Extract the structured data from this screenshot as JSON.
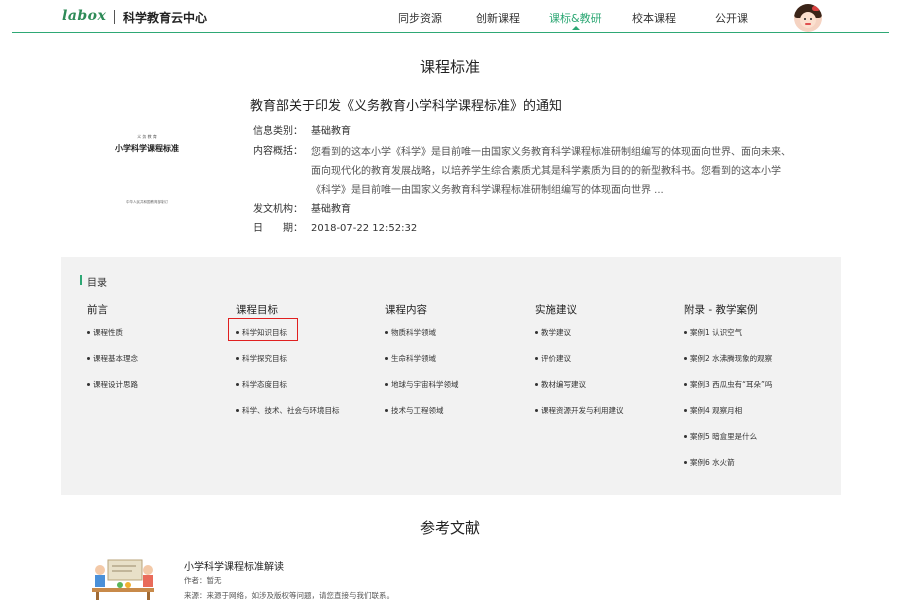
{
  "header": {
    "logo": "labox",
    "site_title": "科学教育云中心",
    "nav": [
      {
        "label": "同步资源",
        "active": false
      },
      {
        "label": "创新课程",
        "active": false
      },
      {
        "label": "课标&教研",
        "active": true
      },
      {
        "label": "校本课程",
        "active": false
      },
      {
        "label": "公开课",
        "active": false
      }
    ],
    "accent_color": "#2ea875"
  },
  "main": {
    "section_title": "课程标准",
    "document": {
      "cover_top": "义 务 教 育",
      "cover_title": "小学科学课程标准",
      "cover_bottom": "中华人民共和国教育部制订",
      "title": "教育部关于印发《义务教育小学科学课程标准》的通知",
      "meta": [
        {
          "label": "信息类别：",
          "value": "基础教育"
        },
        {
          "label": "内容概括：",
          "value": ""
        },
        {
          "label": "发文机构：",
          "value": "基础教育"
        },
        {
          "label": "日　　期：",
          "value": "2018-07-22 12:52:32"
        }
      ],
      "summary_lines": [
        "您看到的这本小学《科学》是目前唯一由国家义务教育科学课程标准研制组编写的体现面向世界、面向未来、",
        "面向现代化的教育发展战略，以培养学生综合素质尤其是科学素质为目的的新型教科书。您看到的这本小学",
        "《科学》是目前唯一由国家义务教育科学课程标准研制组编写的体现面向世界 ..."
      ]
    },
    "toc": {
      "label": "目录",
      "columns": [
        {
          "heading": "前言",
          "items": [
            "课程性质",
            "课程基本理念",
            "课程设计思路"
          ]
        },
        {
          "heading": "课程目标",
          "items": [
            "科学知识目标",
            "科学探究目标",
            "科学态度目标",
            "科学、技术、社会与环境目标"
          ]
        },
        {
          "heading": "课程内容",
          "items": [
            "物质科学领域",
            "生命科学领域",
            "地球与宇宙科学领域",
            "技术与工程领域"
          ]
        },
        {
          "heading": "实施建议",
          "items": [
            "教学建议",
            "评价建议",
            "教材编写建议",
            "课程资源开发与利用建议"
          ]
        },
        {
          "heading": "附录 - 教学案例",
          "items": [
            "案例1 认识空气",
            "案例2 水沸腾现象的观察",
            "案例3 西瓜虫有“耳朵”吗",
            "案例4 观察月相",
            "案例5 暗盒里是什么",
            "案例6 水火箭"
          ]
        }
      ]
    },
    "references": {
      "section_title": "参考文献",
      "items": [
        {
          "title": "小学科学课程标准解读",
          "author": "作者：暂无",
          "source": "来源：来源于网络，如涉及版权等问题，请您直接与我们联系。"
        }
      ]
    }
  }
}
